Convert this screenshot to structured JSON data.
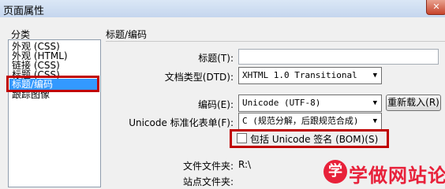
{
  "window": {
    "title": "页面属性",
    "close_glyph": "✕"
  },
  "category": {
    "heading": "分类",
    "items": [
      "外观 (CSS)",
      "外观 (HTML)",
      "链接 (CSS)",
      "标题 (CSS)",
      "标题/编码",
      "跟踪图像"
    ],
    "selected": "标题/编码"
  },
  "section": {
    "heading": "标题/编码",
    "title_label": "标题(T):",
    "title_value": "",
    "doctype_label": "文档类型(DTD):",
    "doctype_value": "XHTML 1.0 Transitional",
    "encoding_label": "编码(E):",
    "encoding_value": "Unicode (UTF-8)",
    "reload_button": "重新载入(R)",
    "normalization_label": "Unicode 标准化表单(F):",
    "normalization_value": "C (规范分解，后跟规范合成)",
    "bom_checkbox_label": "包括 Unicode 签名 (BOM)(S)",
    "bom_checked": false,
    "doc_folder_label": "文件文件夹:",
    "doc_folder_value": "R:\\",
    "site_folder_label": "站点文件夹:",
    "site_folder_value": ""
  },
  "watermark": {
    "glyph": "学",
    "text": "学做网站论坛"
  },
  "colors": {
    "highlight": "#3399ff",
    "annotation_red": "#c00000",
    "watermark_red": "#e8213a"
  }
}
